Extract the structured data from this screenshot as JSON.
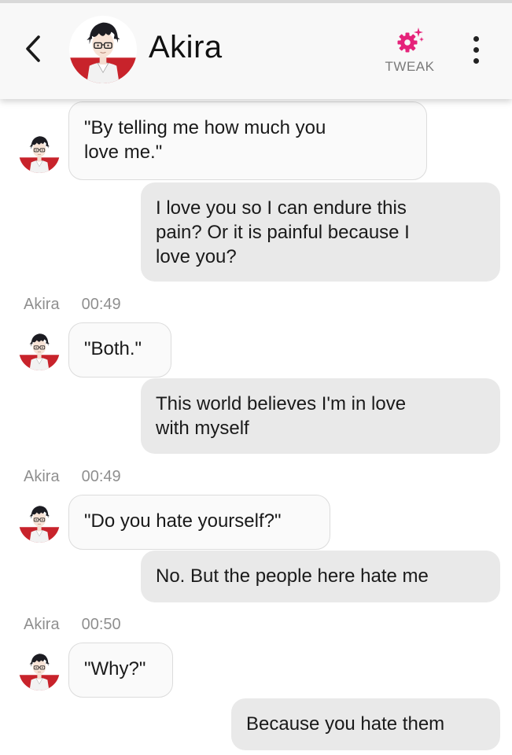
{
  "header": {
    "contact_name": "Akira",
    "tweak_label": "TWEAK",
    "back_icon": "chevron-left-icon",
    "tweak_icon": "gear-sparkle-icon",
    "more_icon": "vertical-dots-icon",
    "accent_color": "#e5237a"
  },
  "messages": [
    {
      "direction": "in",
      "text": "\"By telling me how much you\nlove me.\""
    },
    {
      "direction": "out",
      "text": "I love you so I can endure this\npain? Or it is painful because I\nlove you?"
    },
    {
      "direction": "meta",
      "sender": "Akira",
      "time": "00:49"
    },
    {
      "direction": "in",
      "text": "\"Both.\""
    },
    {
      "direction": "out",
      "text": "This world believes I'm in love\nwith myself"
    },
    {
      "direction": "meta",
      "sender": "Akira",
      "time": "00:49"
    },
    {
      "direction": "in",
      "text": "\"Do you hate yourself?\""
    },
    {
      "direction": "out",
      "text": "No. But the people here hate me"
    },
    {
      "direction": "meta",
      "sender": "Akira",
      "time": "00:50"
    },
    {
      "direction": "in",
      "text": "\"Why?\""
    },
    {
      "direction": "out",
      "text": "Because you hate them"
    }
  ]
}
